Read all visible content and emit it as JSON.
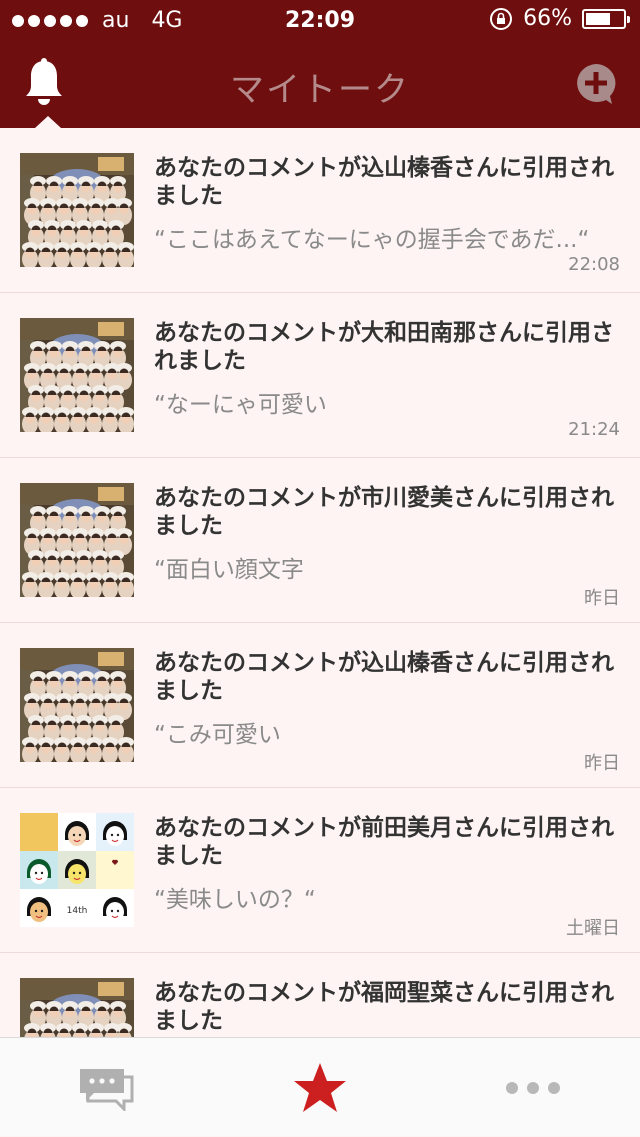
{
  "status_bar": {
    "carrier": "au",
    "network": "4G",
    "time": "22:09",
    "battery": "66%",
    "battery_level": 0.66
  },
  "nav": {
    "title": "マイトーク"
  },
  "notifications": [
    {
      "title": "あなたのコメントが込山榛香さんに引用されました",
      "quote": "“ここはあえてなーにゃの握手会であだ...“",
      "time": "22:08",
      "thumb": "group-photo"
    },
    {
      "title": "あなたのコメントが大和田南那さんに引用されました",
      "quote": "“なーにゃ可愛い",
      "time": "21:24",
      "thumb": "group-photo"
    },
    {
      "title": "あなたのコメントが市川愛美さんに引用されました",
      "quote": "“面白い顔文字",
      "time": "昨日",
      "thumb": "group-photo"
    },
    {
      "title": "あなたのコメントが込山榛香さんに引用されました",
      "quote": "“こみ可愛い",
      "time": "昨日",
      "thumb": "group-photo"
    },
    {
      "title": "あなたのコメントが前田美月さんに引用されました",
      "quote": "“美味しいの？“",
      "time": "土曜日",
      "thumb": "avatar-collage",
      "collage_text": "14th"
    },
    {
      "title": "あなたのコメントが福岡聖菜さんに引用されました",
      "quote": "",
      "time": "",
      "thumb": "group-photo"
    }
  ],
  "colors": {
    "header": "#6e0e0f",
    "accent_star": "#cc1f1f",
    "list_bg": "#fdf4f3"
  },
  "tabs": [
    {
      "icon": "chat-icon"
    },
    {
      "icon": "star-icon",
      "active": true
    },
    {
      "icon": "more-icon"
    }
  ]
}
